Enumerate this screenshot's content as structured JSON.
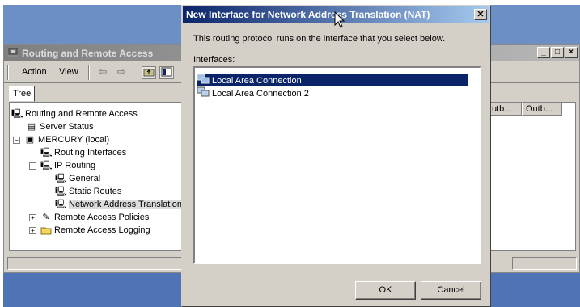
{
  "background_window": {
    "title": "Routing and Remote Access",
    "menu": {
      "action": "Action",
      "view": "View"
    },
    "tab": "Tree",
    "tree": [
      {
        "label": "Routing and Remote Access",
        "icon": "server-computer-icon"
      },
      {
        "label": "Server Status",
        "icon": "server-icon"
      },
      {
        "label": "MERCURY (local)",
        "icon": "server-computer-icon"
      },
      {
        "label": "Routing Interfaces",
        "icon": "network-icon"
      },
      {
        "label": "IP Routing",
        "icon": "network-icon"
      },
      {
        "label": "General",
        "icon": "network-icon"
      },
      {
        "label": "Static Routes",
        "icon": "network-icon"
      },
      {
        "label": "Network Address Translation",
        "icon": "network-icon"
      },
      {
        "label": "Remote Access Policies",
        "icon": "policy-icon"
      },
      {
        "label": "Remote Access Logging",
        "icon": "folder-icon"
      }
    ],
    "columns": [
      "utb...",
      "Outb..."
    ]
  },
  "dialog": {
    "title": "New Interface for Network Address Translation (NAT)",
    "description": "This routing protocol runs on the interface that you select below.",
    "interfaces_label": "Interfaces:",
    "interfaces": [
      {
        "label": "Local Area Connection",
        "selected": true
      },
      {
        "label": "Local Area Connection 2",
        "selected": false
      }
    ],
    "ok_label": "OK",
    "cancel_label": "Cancel",
    "close_glyph": "✕"
  },
  "colors": {
    "dialog_title_start": "#0a246a",
    "dialog_title_end": "#a6caf0",
    "selection": "#0a246a",
    "desktop_blue": "#4f74b6"
  }
}
